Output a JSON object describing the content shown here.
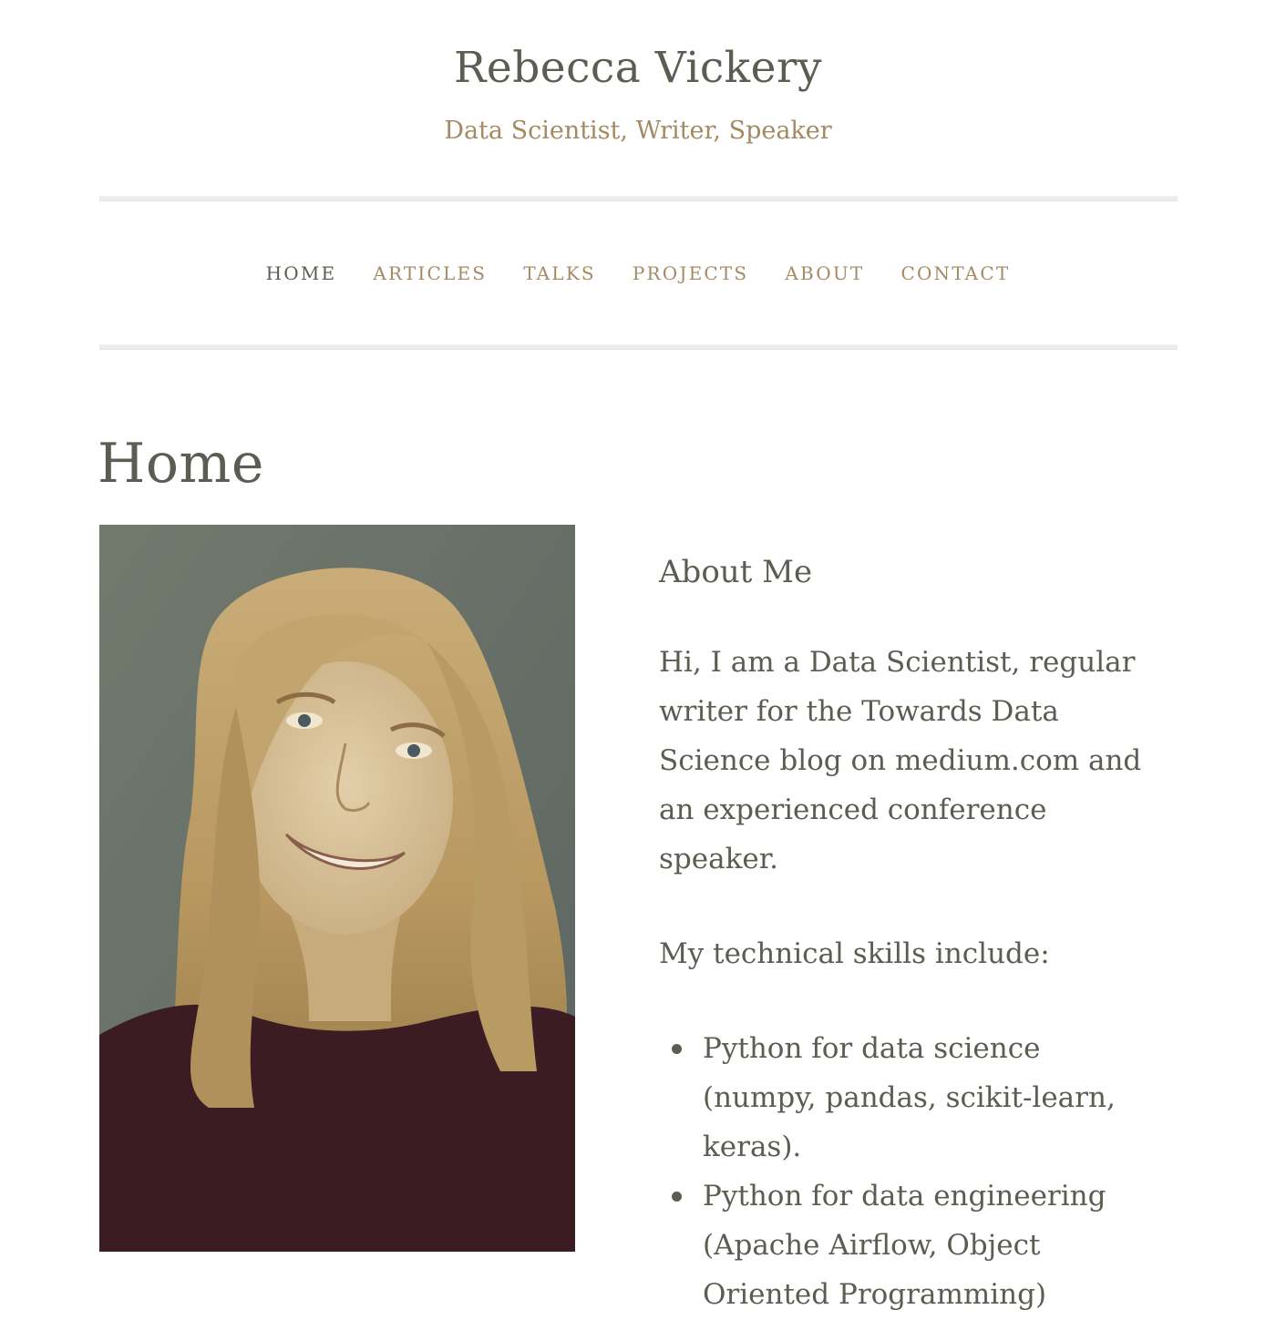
{
  "site": {
    "title": "Rebecca Vickery",
    "tagline": "Data Scientist, Writer, Speaker"
  },
  "nav": {
    "items": [
      {
        "label": "HOME",
        "active": true
      },
      {
        "label": "ARTICLES",
        "active": false
      },
      {
        "label": "TALKS",
        "active": false
      },
      {
        "label": "PROJECTS",
        "active": false
      },
      {
        "label": "ABOUT",
        "active": false
      },
      {
        "label": "CONTACT",
        "active": false
      }
    ]
  },
  "page": {
    "title": "Home"
  },
  "about": {
    "heading": "About Me",
    "intro": "Hi, I am a Data Scientist, regular writer for the Towards Data Science blog on medium.com and an experienced conference speaker.",
    "skills_intro": "My technical skills include:",
    "skills": [
      "Python for data science (numpy, pandas, scikit-learn, keras).",
      "Python for data engineering (Apache Airflow, Object Oriented Programming)"
    ]
  },
  "colors": {
    "text": "#5c5c52",
    "accent": "#a48a63",
    "rule": "#ececec"
  }
}
